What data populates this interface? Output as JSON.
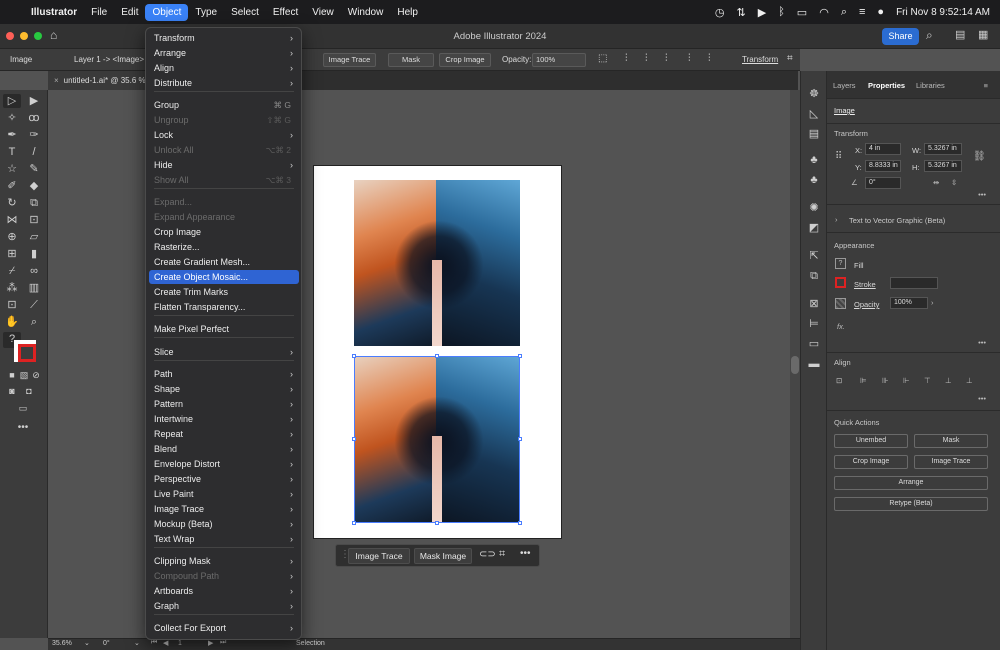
{
  "menubar": {
    "apple": "",
    "app": "Illustrator",
    "items": [
      "File",
      "Edit",
      "Object",
      "Type",
      "Select",
      "Effect",
      "View",
      "Window",
      "Help"
    ],
    "active": "Object",
    "clock": "Fri Nov 8  9:52:14 AM"
  },
  "titlebar": {
    "title": "Adobe Illustrator 2024",
    "share": "Share"
  },
  "controlbar": {
    "selection_type": "Image",
    "breadcrumb": "Layer 1 -> <Image>",
    "image_trace": "Image Trace",
    "mask": "Mask",
    "crop_image": "Crop Image",
    "opacity_label": "Opacity:",
    "opacity_value": "100%",
    "transform": "Transform"
  },
  "doc_tab": {
    "title": "untitled-1.ai* @ 35.6 %"
  },
  "object_menu": {
    "items": [
      {
        "label": "Transform",
        "sub": true
      },
      {
        "label": "Arrange",
        "sub": true
      },
      {
        "label": "Align",
        "sub": true
      },
      {
        "label": "Distribute",
        "sub": true
      },
      {
        "label": "Group",
        "shortcut": "⌘ G"
      },
      {
        "label": "Ungroup",
        "shortcut": "⇧⌘ G",
        "disabled": true
      },
      {
        "label": "Lock",
        "sub": true
      },
      {
        "label": "Unlock All",
        "shortcut": "⌥⌘ 2",
        "disabled": true
      },
      {
        "label": "Hide",
        "sub": true
      },
      {
        "label": "Show All",
        "shortcut": "⌥⌘ 3",
        "disabled": true
      },
      {
        "label": "Expand...",
        "disabled": true
      },
      {
        "label": "Expand Appearance",
        "disabled": true
      },
      {
        "label": "Crop Image"
      },
      {
        "label": "Rasterize..."
      },
      {
        "label": "Create Gradient Mesh..."
      },
      {
        "label": "Create Object Mosaic...",
        "highlighted": true
      },
      {
        "label": "Create Trim Marks"
      },
      {
        "label": "Flatten Transparency..."
      },
      {
        "label": "Make Pixel Perfect"
      },
      {
        "label": "Slice",
        "sub": true
      },
      {
        "label": "Path",
        "sub": true
      },
      {
        "label": "Shape",
        "sub": true
      },
      {
        "label": "Pattern",
        "sub": true
      },
      {
        "label": "Intertwine",
        "sub": true
      },
      {
        "label": "Repeat",
        "sub": true
      },
      {
        "label": "Blend",
        "sub": true
      },
      {
        "label": "Envelope Distort",
        "sub": true
      },
      {
        "label": "Perspective",
        "sub": true
      },
      {
        "label": "Live Paint",
        "sub": true
      },
      {
        "label": "Image Trace",
        "sub": true
      },
      {
        "label": "Mockup (Beta)",
        "sub": true
      },
      {
        "label": "Text Wrap",
        "sub": true
      },
      {
        "label": "Clipping Mask",
        "sub": true
      },
      {
        "label": "Compound Path",
        "sub": true,
        "disabled": true
      },
      {
        "label": "Artboards",
        "sub": true
      },
      {
        "label": "Graph",
        "sub": true
      },
      {
        "label": "Collect For Export",
        "sub": true
      }
    ],
    "arrow": "›"
  },
  "context_bar": {
    "image_trace": "Image Trace",
    "mask_image": "Mask Image"
  },
  "panel": {
    "tabs": [
      "Layers",
      "Properties",
      "Libraries"
    ],
    "active_tab": "Properties",
    "object_type": "Image",
    "transform": {
      "title": "Transform",
      "x_label": "X:",
      "x": "4 in",
      "y_label": "Y:",
      "y": "8.8333 in",
      "w_label": "W:",
      "w": "5.3267 in",
      "h_label": "H:",
      "h": "5.3267 in",
      "angle": "0°"
    },
    "text_to_vector": "Text to Vector Graphic (Beta)",
    "appearance": {
      "title": "Appearance",
      "fill": "Fill",
      "stroke": "Stroke",
      "opacity_label": "Opacity",
      "opacity": "100%",
      "fx": "fx."
    },
    "align": {
      "title": "Align"
    },
    "quick_actions": {
      "title": "Quick Actions",
      "unembed": "Unembed",
      "mask": "Mask",
      "crop_image": "Crop Image",
      "image_trace": "Image Trace",
      "arrange": "Arrange",
      "retype": "Retype (Beta)"
    }
  },
  "bottom_bar": {
    "zoom": "35.6%",
    "rotation": "0°",
    "artboard": "1",
    "tool": "Selection"
  },
  "colors": {
    "accent": "#2f64d3",
    "share": "#2b6cd1"
  }
}
